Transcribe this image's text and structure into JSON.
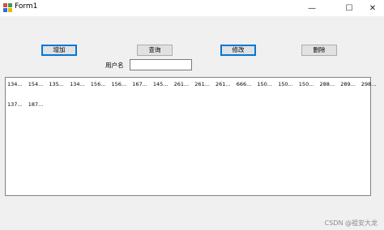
{
  "window": {
    "title": "Form1",
    "minimize_glyph": "—",
    "maximize_glyph": "☐",
    "close_glyph": "✕"
  },
  "toolbar": {
    "add_label": "增加",
    "query_label": "查询",
    "edit_label": "修改",
    "delete_label": "删除"
  },
  "form": {
    "username_label": "用户名",
    "username_value": ""
  },
  "list": {
    "row1": [
      "134...",
      "154...",
      "135...",
      "134...",
      "156...",
      "156...",
      "167...",
      "145...",
      "261...",
      "261...",
      "261...",
      "666...",
      "150...",
      "150...",
      "150...",
      "288...",
      "289...",
      "298..."
    ],
    "row2": [
      "137...",
      "187..."
    ]
  },
  "watermark": "CSDN @祖安大龙",
  "colors": {
    "focus": "#0078d7",
    "button_bg": "#e1e1e1",
    "window_bg": "#f0f0f0"
  }
}
